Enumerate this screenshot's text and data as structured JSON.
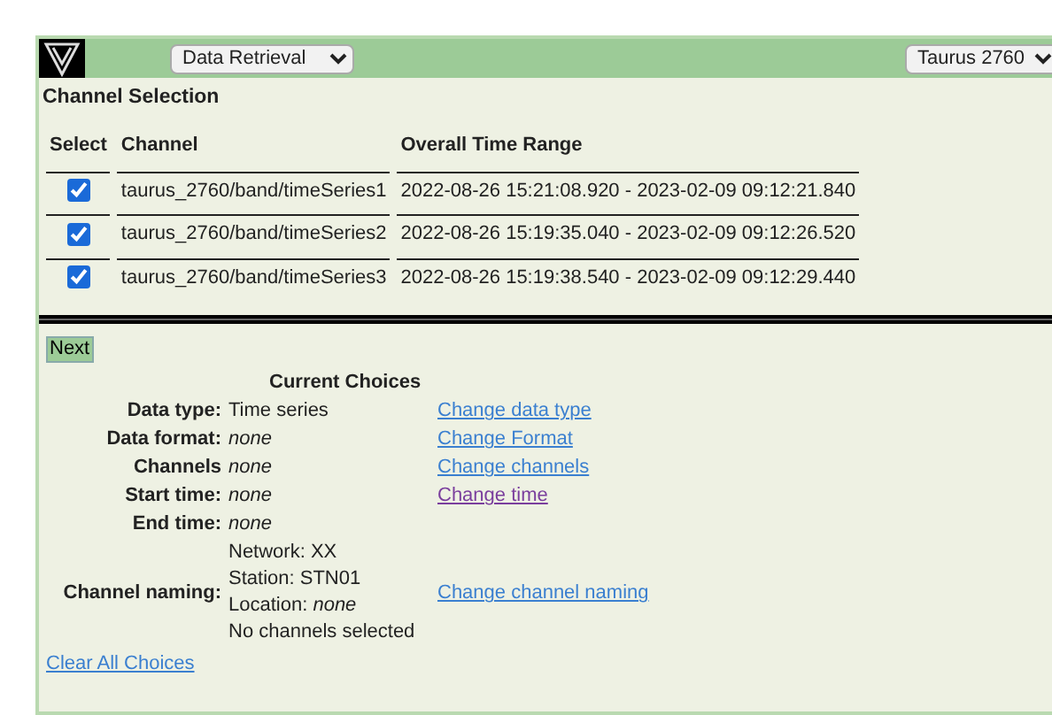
{
  "toolbar": {
    "mode_select": "Data Retrieval",
    "device_select": "Taurus 2760"
  },
  "channel_selection": {
    "title": "Channel Selection",
    "columns": [
      "Select",
      "Channel",
      "Overall Time Range"
    ],
    "rows": [
      {
        "checked": true,
        "channel": "taurus_2760/band/timeSeries1",
        "time_range": "2022-08-26 15:21:08.920 - 2023-02-09 09:12:21.840"
      },
      {
        "checked": true,
        "channel": "taurus_2760/band/timeSeries2",
        "time_range": "2022-08-26 15:19:35.040 - 2023-02-09 09:12:26.520"
      },
      {
        "checked": true,
        "channel": "taurus_2760/band/timeSeries3",
        "time_range": "2022-08-26 15:19:38.540 - 2023-02-09 09:12:29.440"
      }
    ]
  },
  "next_button": "Next",
  "current_choices": {
    "title": "Current Choices",
    "rows": [
      {
        "label": "Data type:",
        "values": [
          "Time series"
        ],
        "italic": false,
        "link": "Change data type",
        "visited": false
      },
      {
        "label": "Data format:",
        "values": [
          "none"
        ],
        "italic": true,
        "link": "Change Format",
        "visited": false
      },
      {
        "label": "Channels",
        "values": [
          "none"
        ],
        "italic": true,
        "link": "Change channels",
        "visited": false
      },
      {
        "label": "Start time:",
        "values": [
          "none"
        ],
        "italic": true,
        "link": "Change time",
        "visited": true
      },
      {
        "label": "End time:",
        "values": [
          "none"
        ],
        "italic": true
      },
      {
        "label": "Channel naming:",
        "values": [
          "Network: XX",
          "Station: STN01",
          "Location: *none*",
          "No channels selected"
        ],
        "italic": false,
        "link": "Change channel naming",
        "visited": false
      }
    ]
  },
  "clear_link": "Clear All Choices"
}
